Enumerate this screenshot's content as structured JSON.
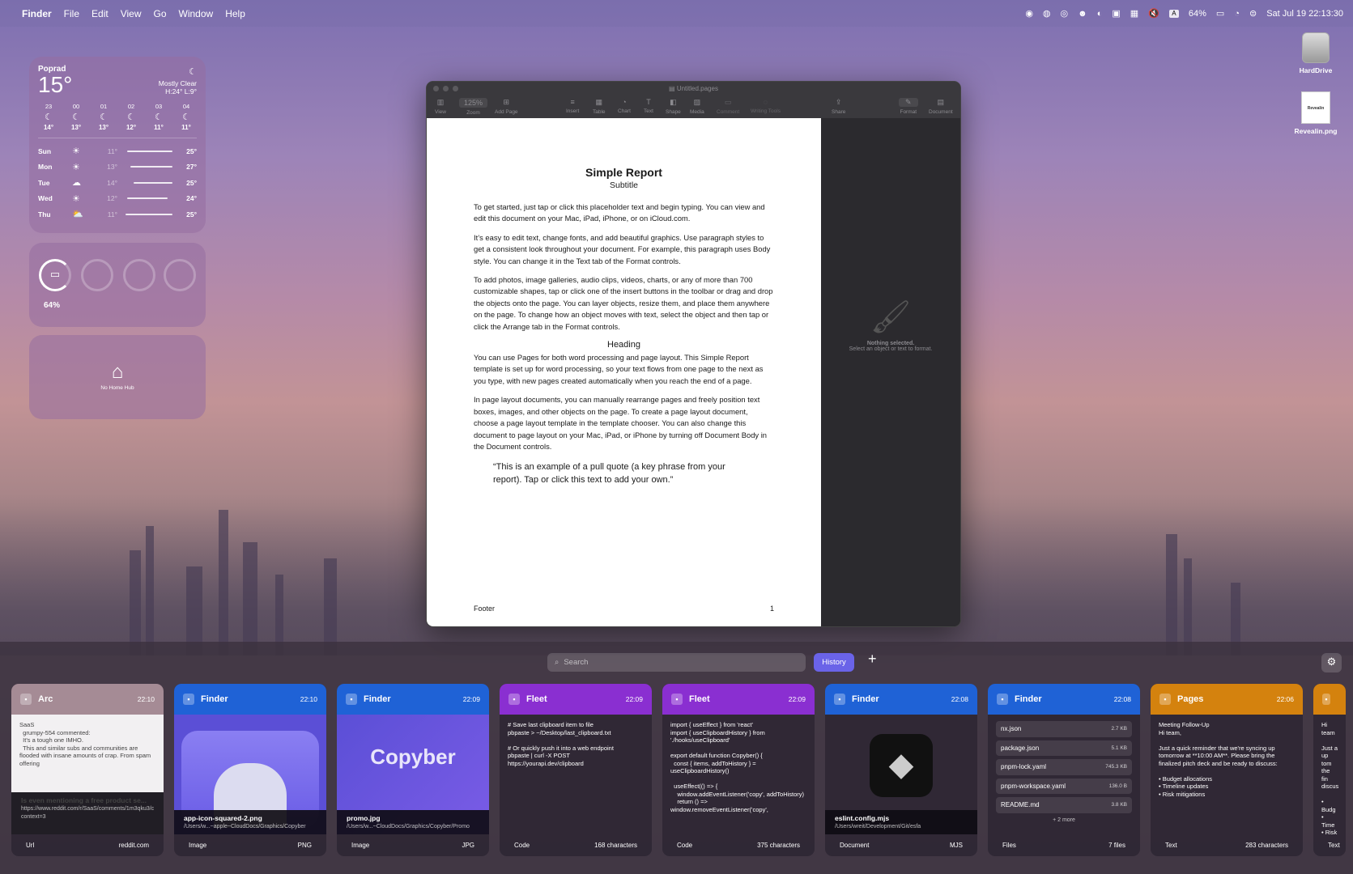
{
  "menubar": {
    "apple": "",
    "app": "Finder",
    "menus": [
      "File",
      "Edit",
      "View",
      "Go",
      "Window",
      "Help"
    ],
    "battery": "64%",
    "datetime": "Sat Jul 19  22:13:30",
    "input": "A"
  },
  "weather": {
    "city": "Poprad",
    "temp": "15°",
    "condition": "Mostly Clear",
    "range": "H:24° L:9°",
    "hours": [
      {
        "h": "23",
        "t": "14°"
      },
      {
        "h": "00",
        "t": "13°"
      },
      {
        "h": "01",
        "t": "13°"
      },
      {
        "h": "02",
        "t": "12°"
      },
      {
        "h": "03",
        "t": "11°"
      },
      {
        "h": "04",
        "t": "11°"
      }
    ],
    "days": [
      {
        "d": "Sun",
        "lo": "11°",
        "hi": "25°",
        "ic": "☀"
      },
      {
        "d": "Mon",
        "lo": "13°",
        "hi": "27°",
        "ic": "☀"
      },
      {
        "d": "Tue",
        "lo": "14°",
        "hi": "25°",
        "ic": "☁"
      },
      {
        "d": "Wed",
        "lo": "12°",
        "hi": "24°",
        "ic": "☀"
      },
      {
        "d": "Thu",
        "lo": "11°",
        "hi": "25°",
        "ic": "⛅"
      }
    ]
  },
  "battery_widget": {
    "percent": "64%"
  },
  "home_widget": {
    "label": "No Home Hub"
  },
  "desktop": {
    "icons": [
      {
        "label": "HardDrive"
      },
      {
        "label": "Revealin.png",
        "thumb": "Revealin"
      }
    ]
  },
  "pages": {
    "window_title": "Untitled.pages",
    "zoom": "125%",
    "toolbar": [
      "View",
      "Zoom",
      "Add Page",
      "Insert",
      "Table",
      "Chart",
      "Text",
      "Shape",
      "Media",
      "Comment",
      "Writing Tools",
      "Share",
      "Format",
      "Document"
    ],
    "title": "Simple Report",
    "subtitle": "Subtitle",
    "p1": "To get started, just tap or click this placeholder text and begin typing. You can view and edit this document on your Mac, iPad, iPhone, or on iCloud.com.",
    "p2": "It’s easy to edit text, change fonts, and add beautiful graphics. Use paragraph styles to get a consistent look throughout your document. For example, this paragraph uses Body style. You can change it in the Text tab of the Format controls.",
    "p3": "To add photos, image galleries, audio clips, videos, charts, or any of more than 700 customizable shapes, tap or click one of the insert buttons in the toolbar or drag and drop the objects onto the page. You can layer objects, resize them, and place them anywhere on the page. To change how an object moves with text, select the object and then tap or click the Arrange tab in the Format controls.",
    "heading": "Heading",
    "p4": "You can use Pages for both word processing and page layout. This Simple Report template is set up for word processing, so your text flows from one page to the next as you type, with new pages created automatically when you reach the end of a page.",
    "p5": "In page layout documents, you can manually rearrange pages and freely position text boxes, images, and other objects on the page. To create a page layout document, choose a page layout template in the template chooser. You can also change this document to page layout on your Mac, iPad, or iPhone by turning off Document Body in the Document controls.",
    "quote": "“This is an example of a pull quote (a key phrase from your report). Tap or click this text to add your own.”",
    "footer": "Footer",
    "page_no": "1",
    "inspector_title": "Nothing selected.",
    "inspector_hint": "Select an object or text to format."
  },
  "clipboard": {
    "search_placeholder": "Search",
    "history": "History",
    "cards": [
      {
        "app": "Arc",
        "time": "22:10",
        "color": "#a58b95",
        "type": "Url",
        "meta": "reddit.com",
        "title": "Is even mentioning a free product se...",
        "sub": "https://www.reddit.com/r/SaaS/comments/1m3qku3/comment/n3ym3gv/?context=3",
        "body": "SaaS\n  grumpy-554 commented:\n  It's a tough one IMHO.\n  This and similar subs and communities are flooded with insane amounts of crap. From spam offering"
      },
      {
        "app": "Finder",
        "time": "22:10",
        "color": "#1f62d6",
        "type": "Image",
        "meta": "PNG",
        "title": "app-icon-squared-2.png",
        "sub": "/Users/w...~apple~CloudDocs/Graphics/Copyber"
      },
      {
        "app": "Finder",
        "time": "22:09",
        "color": "#1f62d6",
        "type": "Image",
        "meta": "JPG",
        "title": "promo.jpg",
        "sub": "/Users/w...~CloudDocs/Graphics/Copyber/Promo",
        "art": "Copyber"
      },
      {
        "app": "Fleet",
        "time": "22:09",
        "color": "#8a2fd1",
        "type": "Code",
        "meta": "168 characters",
        "body": "# Save last clipboard item to file\npbpaste > ~/Desktop/last_clipboard.txt\n\n# Or quickly push it into a web endpoint\npbpaste | curl -X POST https://yourapi.dev/clipboard"
      },
      {
        "app": "Fleet",
        "time": "22:09",
        "color": "#8a2fd1",
        "type": "Code",
        "meta": "375 characters",
        "body": "import { useEffect } from 'react'\nimport { useClipboardHistory } from './hooks/useClipboard'\n\nexport default function Copyber() {\n  const { items, addToHistory } = useClipboardHistory()\n\n  useEffect(() => {\n    window.addEventListener('copy', addToHistory)\n    return () =>\nwindow.removeEventListener('copy',"
      },
      {
        "app": "Finder",
        "time": "22:08",
        "color": "#1f62d6",
        "type": "Document",
        "meta": "MJS",
        "title": "eslint.config.mjs",
        "sub": "/Users/wreit/Development/Git/esfa"
      },
      {
        "app": "Finder",
        "time": "22:08",
        "color": "#1f62d6",
        "type": "Files",
        "meta": "7 files",
        "files": [
          {
            "n": "nx.json",
            "s": "2.7 KB"
          },
          {
            "n": "package.json",
            "s": "5.1 KB"
          },
          {
            "n": "pnpm-lock.yaml",
            "s": "745.3 KB"
          },
          {
            "n": "pnpm-workspace.yaml",
            "s": "136.0 B"
          },
          {
            "n": "README.md",
            "s": "3.8 KB"
          }
        ],
        "more": "+ 2 more"
      },
      {
        "app": "Pages",
        "time": "22:06",
        "color": "#d4820e",
        "type": "Text",
        "meta": "283 characters",
        "body": "Meeting Follow-Up\nHi team,\n\nJust a quick reminder that we're syncing up tomorrow at **10:00 AM**. Please bring the finalized pitch deck and be ready to discuss:\n\n• Budget allocations\n• Timeline updates\n• Risk mitigations"
      },
      {
        "app": "",
        "time": "",
        "color": "#d4820e",
        "type": "Text",
        "meta": "",
        "body": "Hi team\n\nJust a\nup tom\nthe fin\ndiscus\n\n• Budg\n• Time\n• Risk"
      }
    ]
  }
}
